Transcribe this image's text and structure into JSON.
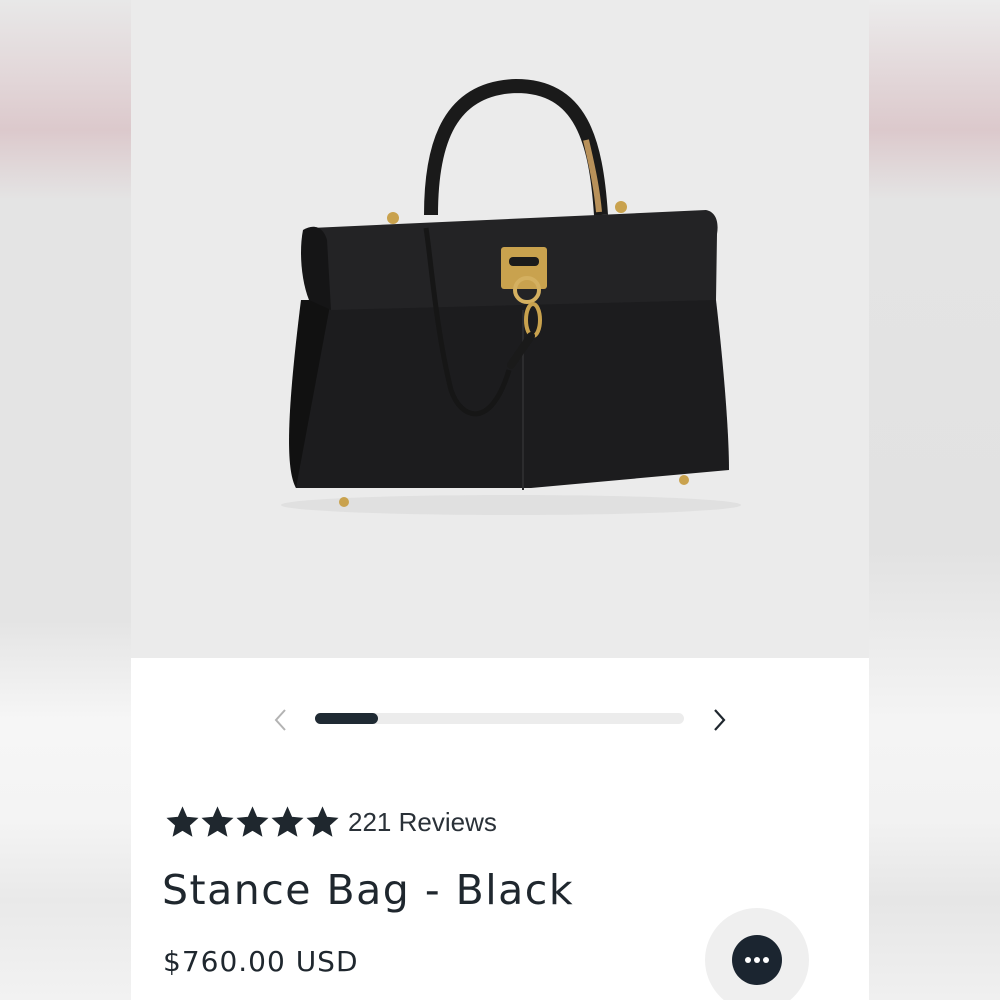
{
  "product": {
    "title": "Stance Bag - Black",
    "price": "$760.00 USD",
    "rating": 5,
    "reviews_label": "221 Reviews",
    "image_subject": "black leather top-handle bag with gold hardware"
  },
  "carousel": {
    "prev_icon": "chevron-left-icon",
    "next_icon": "chevron-right-icon",
    "progress": 0.17
  },
  "chat": {
    "icon": "chat-bubble-icon"
  },
  "colors": {
    "accent": "#1f2a33",
    "text": "#1f272e",
    "hero_bg": "#ebebeb",
    "star": "#1f272e"
  }
}
